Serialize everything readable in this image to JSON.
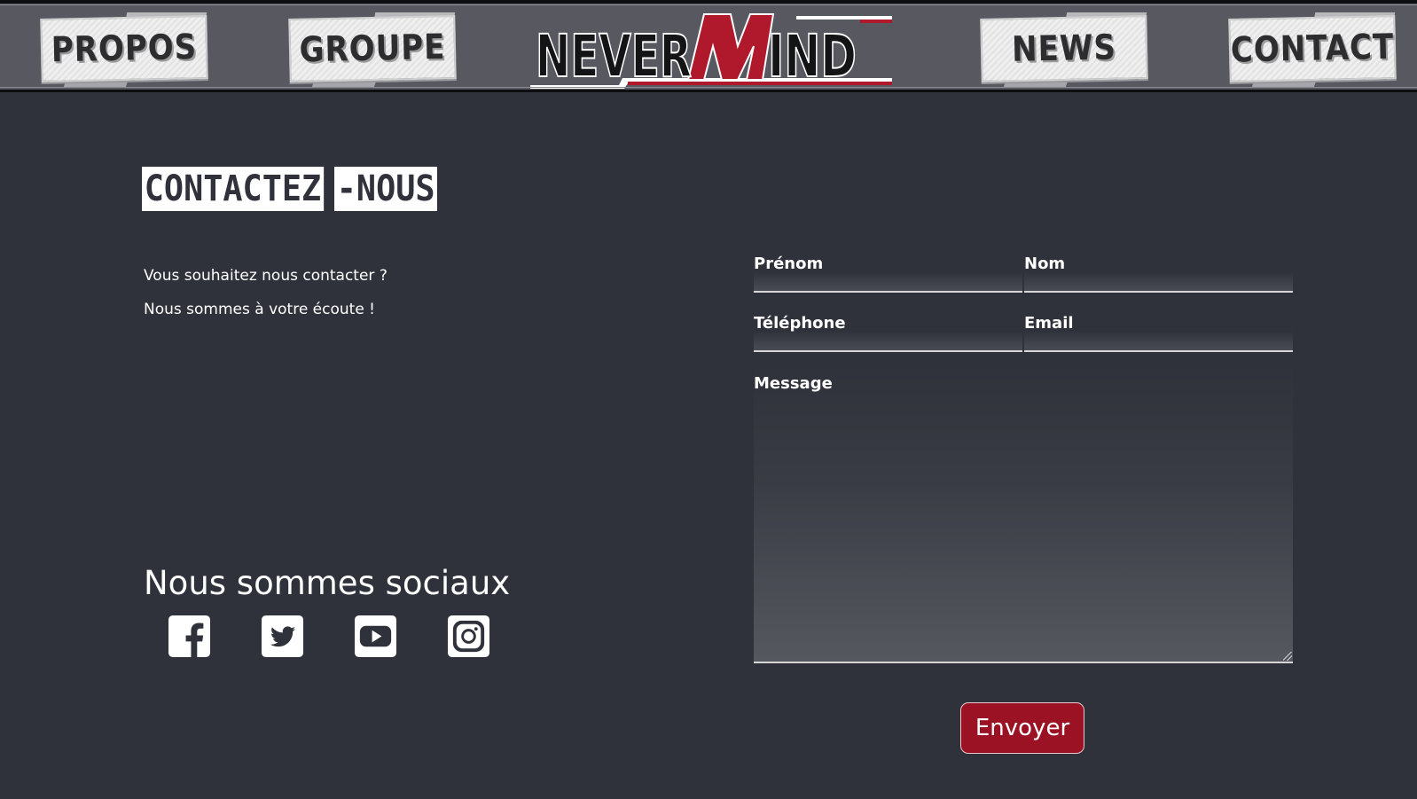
{
  "nav": {
    "items": [
      {
        "label": "PROPOS"
      },
      {
        "label": "GROUPE"
      },
      {
        "label": "NEWS"
      },
      {
        "label": "CONTACT"
      }
    ],
    "logo": {
      "text_part1": "NEVER",
      "text_part2": "M",
      "text_part3": "IND",
      "accent_color": "#b0182b"
    }
  },
  "contact": {
    "title_part1": "CONTACTEZ",
    "title_part2": "-NOUS",
    "intro_line1": "Vous souhaitez nous contacter ?",
    "intro_line2": "Nous sommes à votre écoute !"
  },
  "social": {
    "heading": "Nous sommes sociaux",
    "icons": [
      "facebook-icon",
      "twitter-icon",
      "youtube-icon",
      "instagram-icon"
    ]
  },
  "form": {
    "firstname_label": "Prénom",
    "lastname_label": "Nom",
    "phone_label": "Téléphone",
    "email_label": "Email",
    "message_label": "Message",
    "submit_label": "Envoyer",
    "submit_color": "#9b1224"
  }
}
